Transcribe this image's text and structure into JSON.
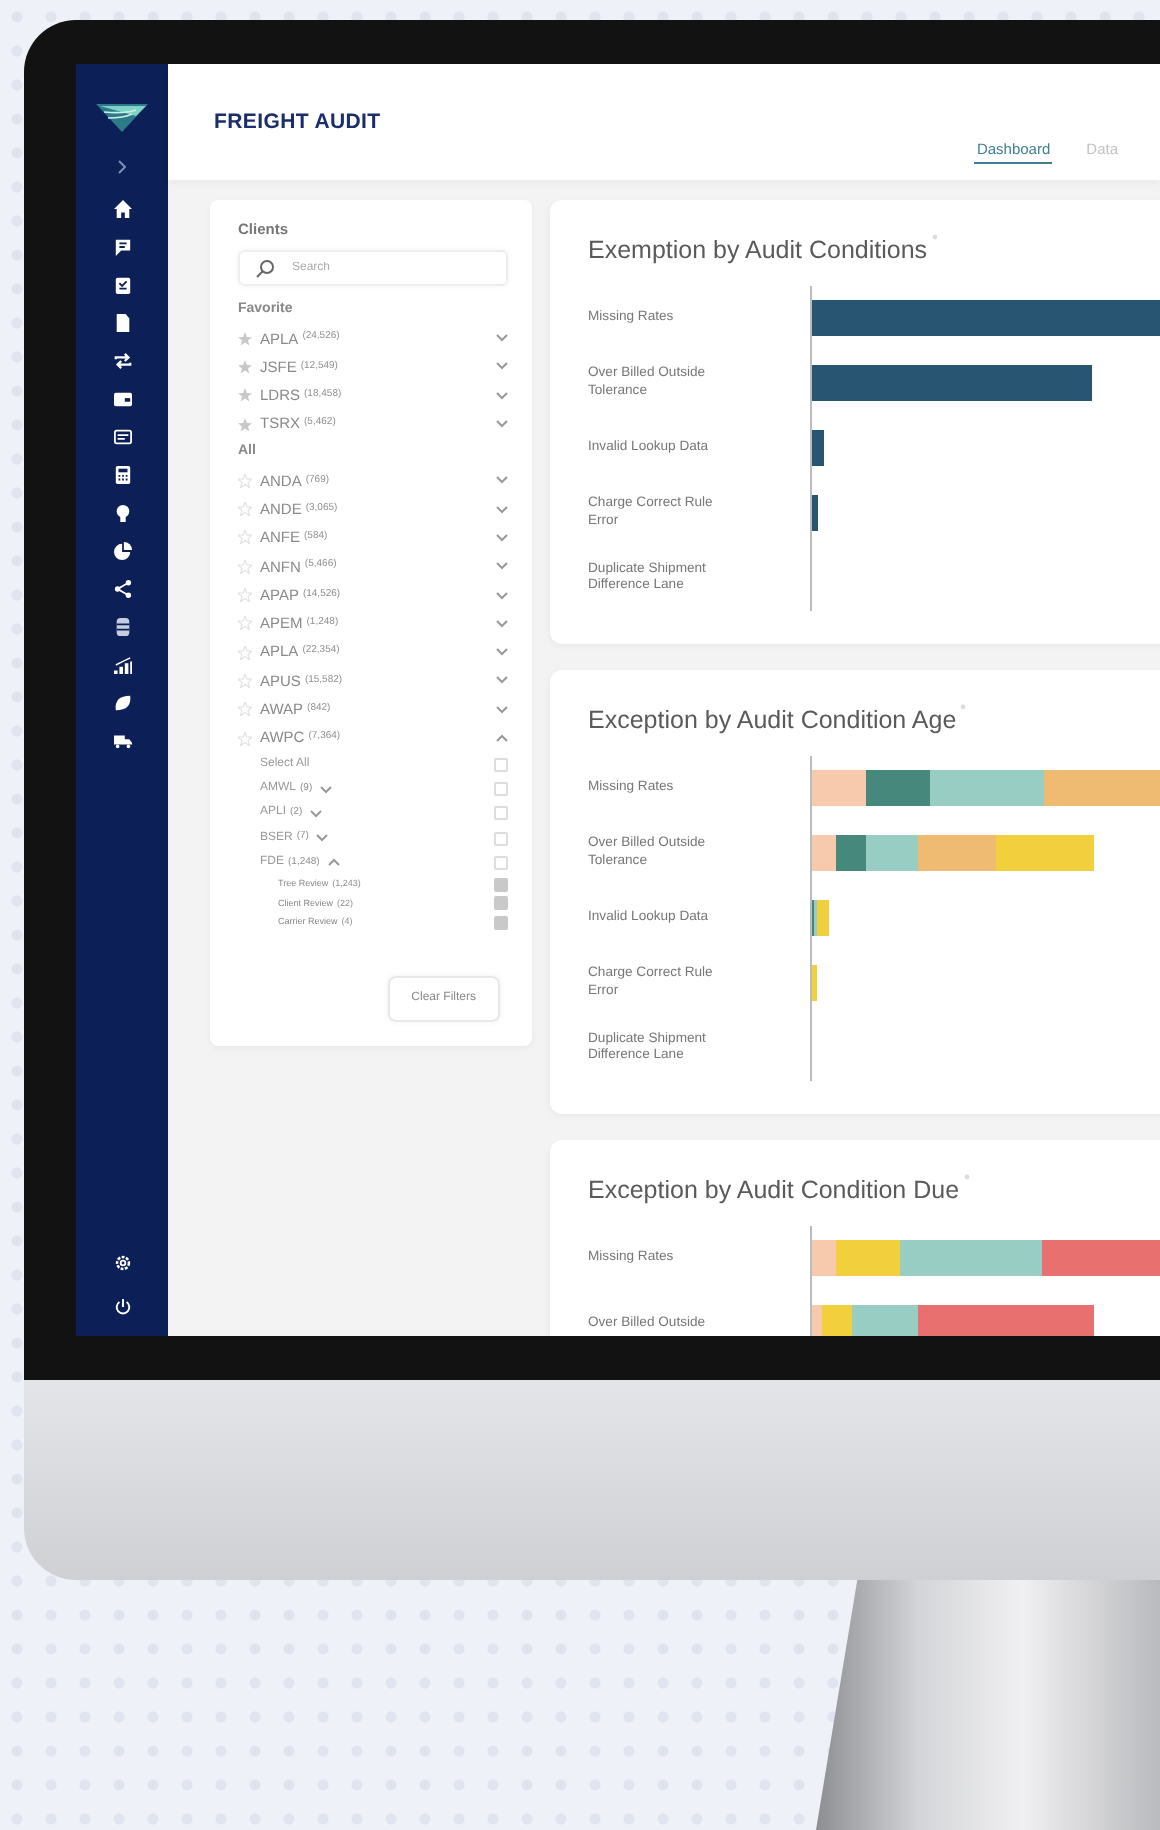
{
  "app": {
    "title": "FREIGHT AUDIT"
  },
  "tabs": [
    {
      "label": "Dashboard",
      "selected": true
    },
    {
      "label": "Data",
      "selected": false
    }
  ],
  "clients": {
    "title": "Clients",
    "search": {
      "placeholder": "Search"
    },
    "favorite_heading": "Favorite",
    "favorites": [
      {
        "code": "APLA",
        "count": "(24,526)",
        "starred": true,
        "expanded": false
      },
      {
        "code": "JSFE",
        "count": "(12,549)",
        "starred": true,
        "expanded": false
      },
      {
        "code": "LDRS",
        "count": "(18,458)",
        "starred": true,
        "expanded": false
      },
      {
        "code": "TSRX",
        "count": "(5,462)",
        "starred": true,
        "expanded": false
      }
    ],
    "all_heading": "All",
    "all": [
      {
        "code": "ANDA",
        "count": "(769)",
        "starred": false,
        "expanded": false
      },
      {
        "code": "ANDE",
        "count": "(3,065)",
        "starred": false,
        "expanded": false
      },
      {
        "code": "ANFE",
        "count": "(584)",
        "starred": false,
        "expanded": false
      },
      {
        "code": "ANFN",
        "count": "(5,466)",
        "starred": false,
        "expanded": false
      },
      {
        "code": "APAP",
        "count": "(14,526)",
        "starred": false,
        "expanded": false
      },
      {
        "code": "APEM",
        "count": "(1,248)",
        "starred": false,
        "expanded": false
      },
      {
        "code": "APLA",
        "count": "(22,354)",
        "starred": false,
        "expanded": false
      },
      {
        "code": "APUS",
        "count": "(15,582)",
        "starred": false,
        "expanded": false
      },
      {
        "code": "AWAP",
        "count": "(842)",
        "starred": false,
        "expanded": false
      },
      {
        "code": "AWPC",
        "count": "(7,364)",
        "starred": false,
        "expanded": true,
        "select_all": {
          "label": "Select All",
          "checked": false
        },
        "children": [
          {
            "code": "AMWL",
            "count": "(9)",
            "checked": false,
            "expanded": false
          },
          {
            "code": "APLI",
            "count": "(2)",
            "checked": false,
            "expanded": false
          },
          {
            "code": "BSER",
            "count": "(7)",
            "checked": false,
            "expanded": false
          },
          {
            "code": "FDE",
            "count": "(1,248)",
            "checked": false,
            "expanded": true,
            "children": [
              {
                "code": "Tree Review",
                "count": "(1,243)",
                "checked": true
              },
              {
                "code": "Client Review",
                "count": "(22)",
                "checked": true
              },
              {
                "code": "Carrier Review",
                "count": "(4)",
                "checked": true
              }
            ]
          }
        ]
      }
    ],
    "clear_button": "Clear Filters"
  },
  "charts": [
    {
      "title": "Exemption by Audit Conditions",
      "kind": "single",
      "rows": [
        "Missing Rates",
        "Over Billed Outside Tolerance",
        "Invalid Lookup Data",
        "Charge Correct Rule Error",
        "Duplicate Shipment Difference Lane"
      ]
    },
    {
      "title": "Exception by Audit Condition Age",
      "kind": "age",
      "rows": [
        "Missing Rates",
        "Over Billed Outside Tolerance",
        "Invalid Lookup Data",
        "Charge Correct Rule Error",
        "Duplicate Shipment Difference Lane"
      ]
    },
    {
      "title": "Exception by Audit Condition Due",
      "kind": "due",
      "rows": [
        "Missing Rates",
        "Over Billed Outside"
      ]
    }
  ]
}
